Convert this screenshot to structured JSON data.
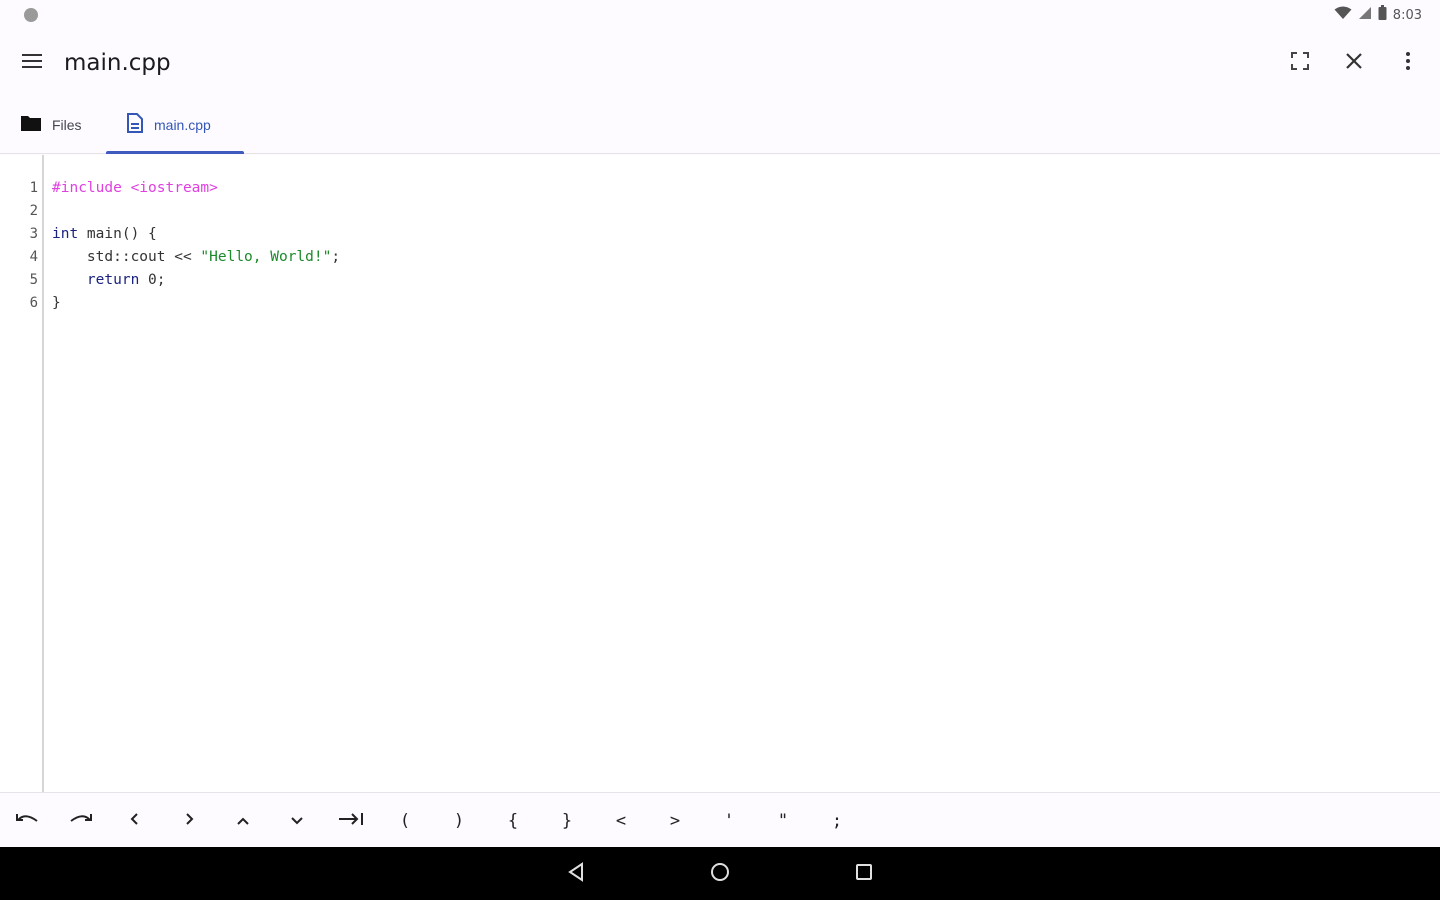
{
  "status_bar": {
    "time": "8:03",
    "icons": [
      "notification-dot-icon",
      "wifi-icon",
      "signal-icon",
      "battery-icon"
    ]
  },
  "app_bar": {
    "title": "main.cpp",
    "icons": [
      "menu-icon",
      "fullscreen-icon",
      "close-icon",
      "more-vert-icon"
    ]
  },
  "tabs": [
    {
      "label": "Files",
      "icon": "folder-icon",
      "selected": false
    },
    {
      "label": "main.cpp",
      "icon": "document-icon",
      "selected": true
    }
  ],
  "editor": {
    "line_numbers": [
      "1",
      "2",
      "3",
      "4",
      "5",
      "6"
    ],
    "lines": {
      "l1_pre": "#include <iostream>",
      "l3_kw": "int",
      "l3_rest": " main() {",
      "l4_indent": "    std::cout << ",
      "l4_str": "\"Hello, World!\"",
      "l4_end": ";",
      "l5_indent": "    ",
      "l5_kw": "return",
      "l5_rest": " 0;",
      "l6": "}"
    }
  },
  "symbol_bar": {
    "keys": [
      "undo",
      "redo",
      "‹",
      "›",
      "^",
      "v",
      "→|",
      "(",
      ")",
      "{",
      "}",
      "<",
      ">",
      "'",
      "\"",
      ";"
    ]
  },
  "nav_bar": {
    "icons": [
      "back-icon",
      "home-icon",
      "recents-icon"
    ]
  },
  "colors": {
    "accent": "#3e5bbd",
    "preprocessor": "#e040e0",
    "keyword": "#1a237e",
    "string": "#1b8a2a"
  }
}
